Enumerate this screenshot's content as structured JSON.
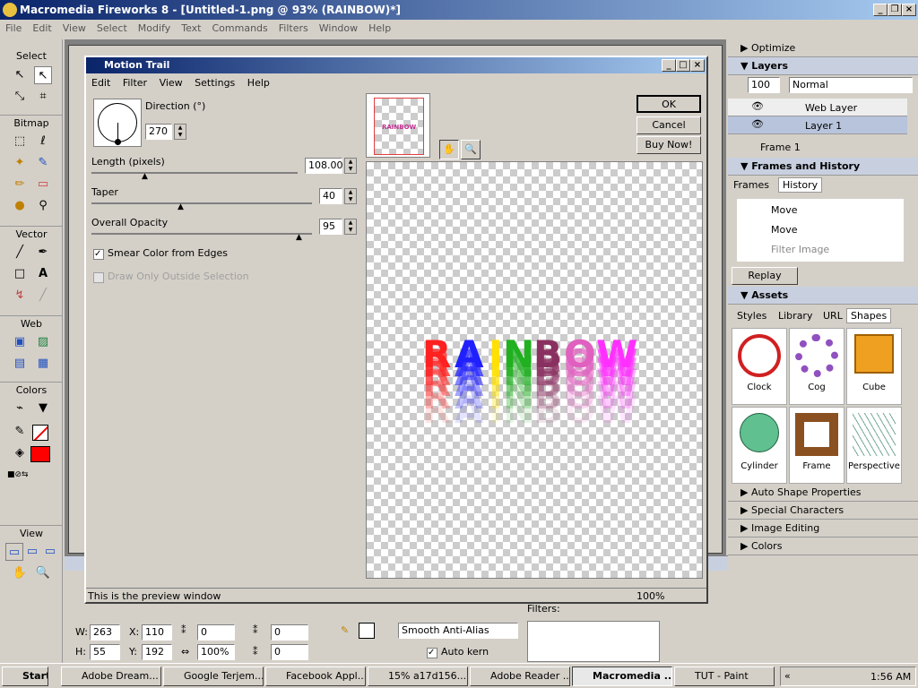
{
  "app": {
    "title": "Macromedia Fireworks 8 - [Untitled-1.png @ 93% (RAINBOW)*]",
    "menu": [
      "File",
      "Edit",
      "View",
      "Select",
      "Modify",
      "Text",
      "Commands",
      "Filters",
      "Window",
      "Help"
    ]
  },
  "toolbox": {
    "sections": [
      "Select",
      "Bitmap",
      "Vector",
      "Web",
      "Colors",
      "View"
    ]
  },
  "dialog": {
    "title": "Motion Trail",
    "menu": [
      "Edit",
      "Filter",
      "View",
      "Settings",
      "Help"
    ],
    "direction_label": "Direction (°)",
    "direction_value": "270",
    "length_label": "Length (pixels)",
    "length_value": "108.00",
    "taper_label": "Taper",
    "taper_value": "40",
    "opacity_label": "Overall Opacity",
    "opacity_value": "95",
    "smear_label": "Smear Color from Edges",
    "draw_only_label": "Draw Only Outside Selection",
    "ok": "OK",
    "cancel": "Cancel",
    "buy": "Buy Now!",
    "thumb_text": "RAINBOW",
    "preview_letters": [
      "R",
      "A",
      "I",
      "N",
      "B",
      "O",
      "W"
    ],
    "status": "This is the preview window",
    "zoom": "100%"
  },
  "dock": {
    "optimize": "Optimize",
    "layers": "Layers",
    "opacity": "100",
    "blend": "Normal",
    "web_layer": "Web Layer",
    "layer1": "Layer 1",
    "frame": "Frame 1",
    "frames_history": "Frames and History",
    "tab_frames": "Frames",
    "tab_history": "History",
    "history": [
      "Move",
      "Move",
      "Filter Image"
    ],
    "replay": "Replay",
    "assets": "Assets",
    "asset_tabs": [
      "Styles",
      "Library",
      "URL",
      "Shapes"
    ],
    "shapes": [
      "Clock",
      "Cog",
      "Cube",
      "Cylinder",
      "Frame",
      "Perspective"
    ],
    "panels": [
      "Auto Shape Properties",
      "Special Characters",
      "Image Editing",
      "Colors"
    ]
  },
  "props": {
    "w_label": "W:",
    "w": "263",
    "h_label": "H:",
    "h": "55",
    "x_label": "X:",
    "x": "110",
    "y_label": "Y:",
    "y": "192",
    "anti_alias": "Smooth Anti-Alias",
    "auto_kern": "Auto kern",
    "filters": "Filters:",
    "v0": "0",
    "v100": "100%",
    "text_name": "RAINBOW"
  },
  "taskbar": {
    "start": "Start",
    "tasks": [
      "Adobe Dream...",
      "Google Terjem...",
      "Facebook Appl...",
      "15% a17d156...",
      "Adobe Reader ...",
      "Macromedia ...",
      "TUT - Paint"
    ],
    "clock": "1:56 AM"
  },
  "colors": {
    "stroke": "#000000",
    "fill": "#ff0000"
  }
}
